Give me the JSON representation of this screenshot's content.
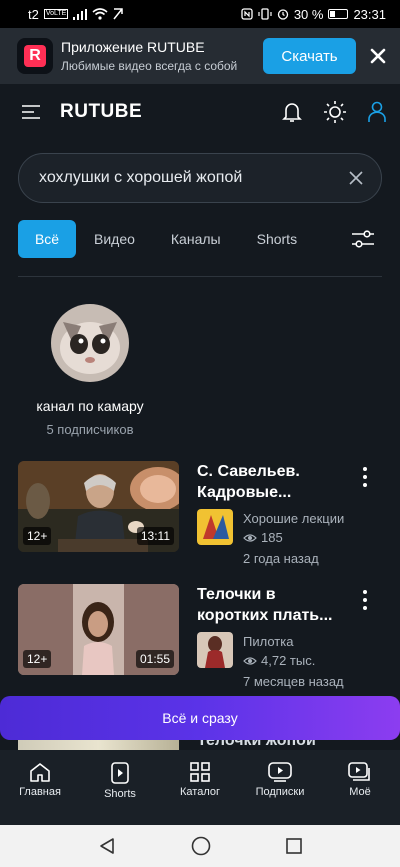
{
  "statusbar": {
    "carrier": "t2",
    "volte": "VoLTE",
    "battery": "30 %",
    "time": "23:31",
    "battery_level": 0.3
  },
  "banner": {
    "title": "Приложение RUTUBE",
    "subtitle": "Любимые видео всегда с собой",
    "download_label": "Скачать"
  },
  "header": {
    "logo": "RUTUBE"
  },
  "search": {
    "query": "хохлушки с хорошей жопой"
  },
  "tabs": [
    {
      "label": "Всё"
    },
    {
      "label": "Видео"
    },
    {
      "label": "Каналы"
    },
    {
      "label": "Shorts"
    }
  ],
  "channel": {
    "name": "канал по камару",
    "subscribers": "5 подписчиков"
  },
  "videos": [
    {
      "title": "С. Савельев. Кадровые...",
      "age": "12+",
      "duration": "13:11",
      "channel": "Хорошие лекции",
      "views": "185",
      "date": "2 года назад"
    },
    {
      "title": "Телочки в коротких плать...",
      "age": "12+",
      "duration": "01:55",
      "channel": "Пилотка",
      "views": "4,72 тыс.",
      "date": "7 месяцев назад"
    },
    {
      "title": "Телочки жопой"
    }
  ],
  "cta": {
    "label": "Всё и сразу"
  },
  "bottomnav": [
    {
      "label": "Главная"
    },
    {
      "label": "Shorts"
    },
    {
      "label": "Каталог"
    },
    {
      "label": "Подписки"
    },
    {
      "label": "Моё"
    }
  ]
}
